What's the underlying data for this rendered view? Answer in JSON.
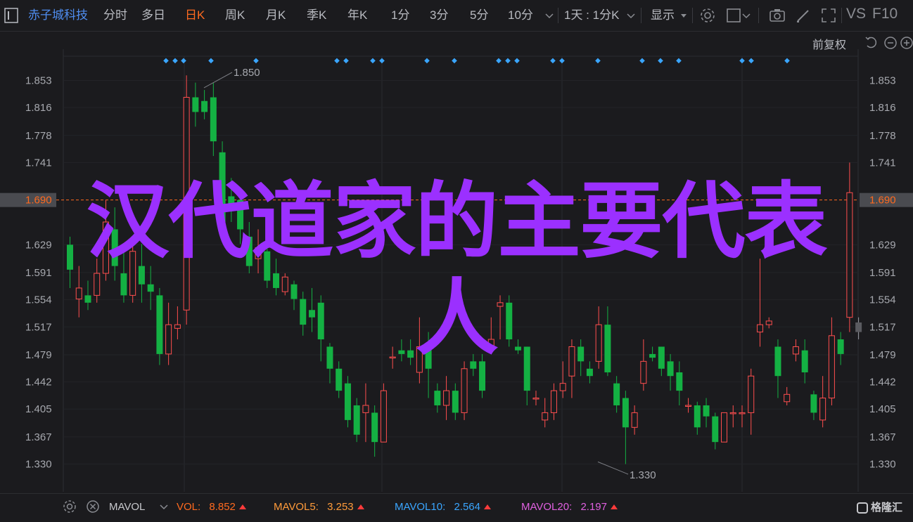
{
  "toolbar": {
    "stock_name": "赤子城科技",
    "periods": [
      "分时",
      "多日",
      "日K",
      "周K",
      "月K",
      "季K",
      "年K",
      "1分",
      "3分",
      "5分",
      "10分"
    ],
    "active_period": "日K",
    "range_select": "1天 : 1分K",
    "display_label": "显示",
    "vs_label": "VS",
    "f10_label": "F10",
    "adjust_label": "前复权"
  },
  "overlay": {
    "line1": "汉代道家的主要代表",
    "line2": "人"
  },
  "chart_data": {
    "type": "candlestick",
    "y_ticks": [
      "1.853",
      "1.816",
      "1.778",
      "1.741",
      "1.629",
      "1.591",
      "1.554",
      "1.517",
      "1.479",
      "1.442",
      "1.405",
      "1.367",
      "1.330"
    ],
    "ylim": [
      1.31,
      1.875
    ],
    "current_price": "1.690",
    "high_label": "1.850",
    "low_label": "1.330",
    "up_color": "#ff4e4e",
    "down_color": "#14b143",
    "current_color": "#ff6a1f",
    "candles": [
      [
        1.629,
        1.595,
        1.64,
        1.57
      ],
      [
        1.555,
        1.57,
        1.6,
        1.53
      ],
      [
        1.56,
        1.55,
        1.58,
        1.54
      ],
      [
        1.56,
        1.59,
        1.61,
        1.55
      ],
      [
        1.59,
        1.66,
        1.69,
        1.58
      ],
      [
        1.65,
        1.6,
        1.68,
        1.58
      ],
      [
        1.59,
        1.56,
        1.62,
        1.55
      ],
      [
        1.56,
        1.62,
        1.63,
        1.55
      ],
      [
        1.6,
        1.575,
        1.63,
        1.55
      ],
      [
        1.575,
        1.565,
        1.6,
        1.54
      ],
      [
        1.56,
        1.48,
        1.57,
        1.465
      ],
      [
        1.48,
        1.52,
        1.55,
        1.465
      ],
      [
        1.515,
        1.52,
        1.545,
        1.5
      ],
      [
        1.54,
        1.83,
        1.86,
        1.52
      ],
      [
        1.83,
        1.81,
        1.85,
        1.79
      ],
      [
        1.825,
        1.81,
        1.84,
        1.8
      ],
      [
        1.83,
        1.77,
        1.85,
        1.75
      ],
      [
        1.755,
        1.66,
        1.77,
        1.64
      ],
      [
        1.695,
        1.68,
        1.72,
        1.66
      ],
      [
        1.69,
        1.65,
        1.7,
        1.63
      ],
      [
        1.64,
        1.6,
        1.66,
        1.59
      ],
      [
        1.61,
        1.625,
        1.65,
        1.59
      ],
      [
        1.62,
        1.58,
        1.63,
        1.57
      ],
      [
        1.59,
        1.57,
        1.61,
        1.56
      ],
      [
        1.565,
        1.585,
        1.59,
        1.56
      ],
      [
        1.575,
        1.555,
        1.58,
        1.54
      ],
      [
        1.555,
        1.52,
        1.565,
        1.505
      ],
      [
        1.54,
        1.53,
        1.57,
        1.51
      ],
      [
        1.55,
        1.5,
        1.56,
        1.47
      ],
      [
        1.49,
        1.46,
        1.495,
        1.44
      ],
      [
        1.46,
        1.43,
        1.47,
        1.42
      ],
      [
        1.44,
        1.39,
        1.45,
        1.38
      ],
      [
        1.41,
        1.37,
        1.42,
        1.36
      ],
      [
        1.4,
        1.41,
        1.44,
        1.36
      ],
      [
        1.4,
        1.36,
        1.41,
        1.34
      ],
      [
        1.36,
        1.43,
        1.44,
        1.36
      ],
      [
        1.475,
        1.476,
        1.49,
        1.46
      ],
      [
        1.485,
        1.48,
        1.5,
        1.47
      ],
      [
        1.485,
        1.475,
        1.5,
        1.465
      ],
      [
        1.455,
        1.49,
        1.53,
        1.44
      ],
      [
        1.495,
        1.46,
        1.51,
        1.42
      ],
      [
        1.43,
        1.41,
        1.44,
        1.4
      ],
      [
        1.41,
        1.43,
        1.45,
        1.39
      ],
      [
        1.43,
        1.4,
        1.44,
        1.39
      ],
      [
        1.4,
        1.46,
        1.47,
        1.39
      ],
      [
        1.47,
        1.46,
        1.48,
        1.45
      ],
      [
        1.47,
        1.43,
        1.48,
        1.42
      ],
      [
        1.49,
        1.5,
        1.53,
        1.48
      ],
      [
        1.545,
        1.55,
        1.56,
        1.5
      ],
      [
        1.55,
        1.5,
        1.56,
        1.49
      ],
      [
        1.49,
        1.485,
        1.5,
        1.48
      ],
      [
        1.49,
        1.43,
        1.49,
        1.41
      ],
      [
        1.42,
        1.42,
        1.43,
        1.41
      ],
      [
        1.39,
        1.4,
        1.42,
        1.38
      ],
      [
        1.4,
        1.43,
        1.44,
        1.39
      ],
      [
        1.43,
        1.44,
        1.47,
        1.42
      ],
      [
        1.45,
        1.49,
        1.5,
        1.42
      ],
      [
        1.49,
        1.47,
        1.5,
        1.45
      ],
      [
        1.46,
        1.45,
        1.47,
        1.44
      ],
      [
        1.47,
        1.52,
        1.545,
        1.46
      ],
      [
        1.52,
        1.455,
        1.545,
        1.45
      ],
      [
        1.44,
        1.41,
        1.45,
        1.4
      ],
      [
        1.42,
        1.38,
        1.43,
        1.33
      ],
      [
        1.38,
        1.4,
        1.41,
        1.37
      ],
      [
        1.44,
        1.47,
        1.5,
        1.43
      ],
      [
        1.48,
        1.475,
        1.49,
        1.47
      ],
      [
        1.49,
        1.46,
        1.49,
        1.45
      ],
      [
        1.47,
        1.45,
        1.48,
        1.43
      ],
      [
        1.455,
        1.43,
        1.47,
        1.41
      ],
      [
        1.41,
        1.41,
        1.42,
        1.4
      ],
      [
        1.41,
        1.38,
        1.415,
        1.37
      ],
      [
        1.41,
        1.395,
        1.42,
        1.38
      ],
      [
        1.395,
        1.36,
        1.4,
        1.35
      ],
      [
        1.36,
        1.4,
        1.4,
        1.36
      ],
      [
        1.4,
        1.4,
        1.41,
        1.38
      ],
      [
        1.4,
        1.4,
        1.41,
        1.38
      ],
      [
        1.4,
        1.45,
        1.46,
        1.37
      ],
      [
        1.51,
        1.52,
        1.61,
        1.49
      ],
      [
        1.52,
        1.525,
        1.53,
        1.515
      ],
      [
        1.49,
        1.45,
        1.5,
        1.42
      ],
      [
        1.415,
        1.425,
        1.435,
        1.41
      ],
      [
        1.48,
        1.49,
        1.5,
        1.47
      ],
      [
        1.485,
        1.455,
        1.5,
        1.44
      ],
      [
        1.425,
        1.4,
        1.43,
        1.39
      ],
      [
        1.39,
        1.42,
        1.45,
        1.38
      ],
      [
        1.42,
        1.505,
        1.53,
        1.41
      ],
      [
        1.5,
        1.48,
        1.51,
        1.465
      ],
      [
        1.53,
        1.7,
        1.741,
        1.51
      ],
      [
        1.523,
        1.51,
        1.53,
        1.5
      ]
    ],
    "markers": [
      "◆",
      "◆",
      "◆",
      "◆",
      "◆",
      "◆",
      "◆",
      "◆",
      "◆",
      "◆",
      "◆",
      "◆",
      "◆",
      "◆",
      "◆",
      "◆",
      "◆",
      "◆",
      "◆",
      "◆",
      "◆",
      "◆",
      "◆"
    ]
  },
  "volume_bar": {
    "indicator": "MAVOL",
    "vol_label": "VOL:",
    "vol_value": "8.852",
    "mavol5_label": "MAVOL5:",
    "mavol5_value": "3.253",
    "mavol10_label": "MAVOL10:",
    "mavol10_value": "2.564",
    "mavol20_label": "MAVOL20:",
    "mavol20_value": "2.197",
    "colors": {
      "vol": "#ff6a1f",
      "mavol5": "#ff9b3a",
      "mavol10": "#3aa6ff",
      "mavol20": "#e060e0"
    }
  },
  "logo": {
    "text": "格隆汇"
  }
}
